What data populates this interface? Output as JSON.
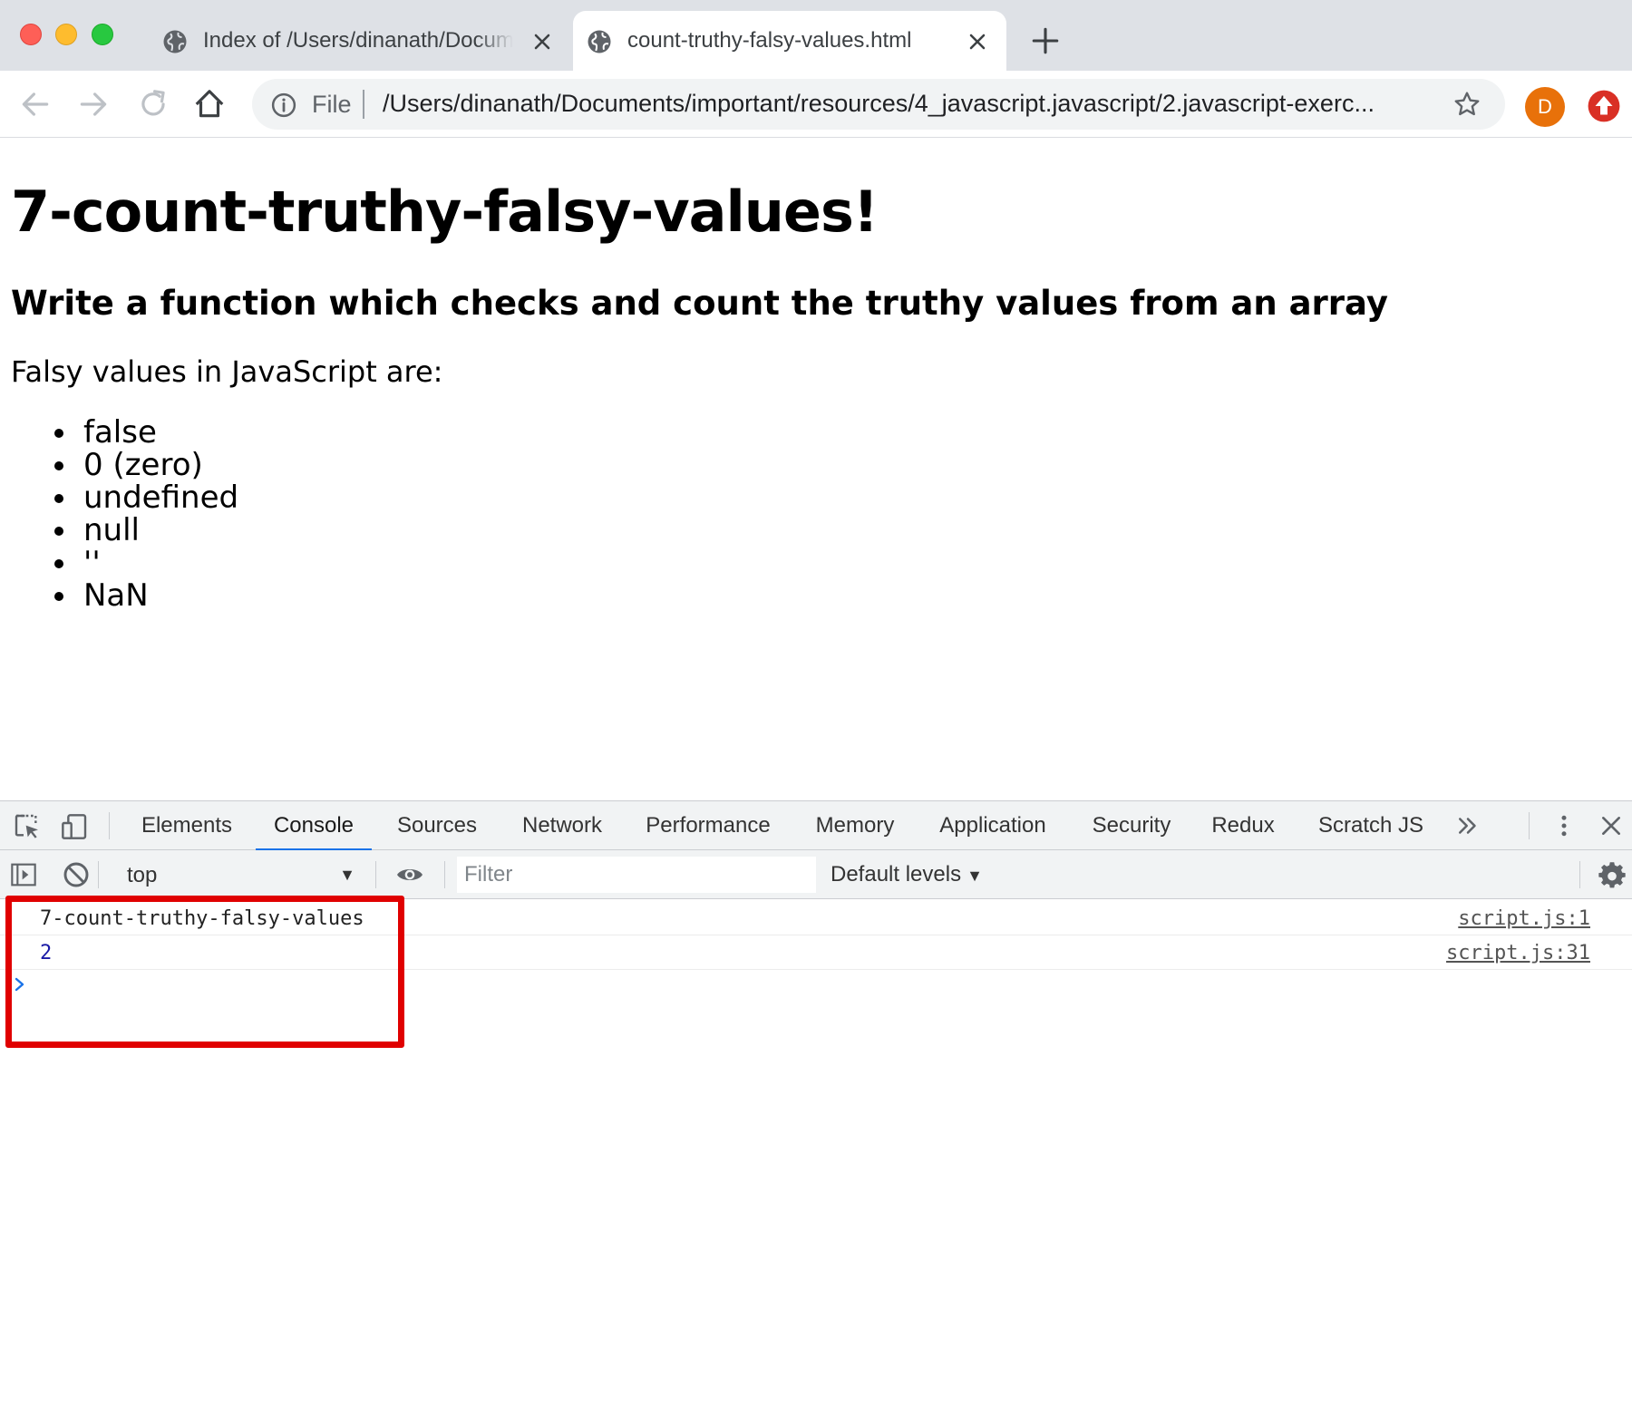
{
  "tabs": [
    {
      "title": "Index of /Users/dinanath/Documents/important",
      "active": false
    },
    {
      "title": "count-truthy-falsy-values.html",
      "active": true
    }
  ],
  "omnibox": {
    "scheme_label": "File",
    "url": "/Users/dinanath/Documents/important/resources/4_javascript.javascript/2.javascript-exerc..."
  },
  "profile": {
    "initial": "D",
    "color": "#e8710a"
  },
  "page": {
    "heading": "7-count-truthy-falsy-values!",
    "subheading": "Write a function which checks and count the truthy values from an array",
    "intro": "Falsy values in JavaScript are:",
    "falsy_list": [
      "false",
      "0 (zero)",
      "undefined",
      "null",
      "''",
      "NaN"
    ]
  },
  "devtools": {
    "tabs": [
      "Elements",
      "Console",
      "Sources",
      "Network",
      "Performance",
      "Memory",
      "Application",
      "Security",
      "Redux",
      "Scratch JS"
    ],
    "selected_tab": "Console",
    "context": "top",
    "filter_placeholder": "Filter",
    "levels_label": "Default levels",
    "messages": [
      {
        "text": "7-count-truthy-falsy-values",
        "source": "script.js:1",
        "kind": "string"
      },
      {
        "text": "2",
        "source": "script.js:31",
        "kind": "number"
      }
    ]
  },
  "colors": {
    "accent": "#1a73e8",
    "highlight_box": "#e00000",
    "console_number": "#1a1aa6"
  }
}
